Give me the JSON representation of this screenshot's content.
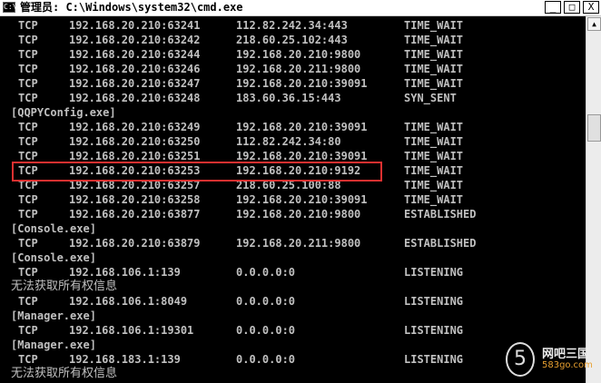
{
  "window": {
    "title": "管理员: C:\\Windows\\system32\\cmd.exe",
    "icon_label": "C:\\",
    "buttons": {
      "minimize": "_",
      "maximize": "□",
      "close": "X"
    }
  },
  "rows": [
    {
      "proto": "TCP",
      "local": "192.168.20.210:63241",
      "foreign": "112.82.242.34:443",
      "state": "TIME_WAIT"
    },
    {
      "proto": "TCP",
      "local": "192.168.20.210:63242",
      "foreign": "218.60.25.102:443",
      "state": "TIME_WAIT"
    },
    {
      "proto": "TCP",
      "local": "192.168.20.210:63244",
      "foreign": "192.168.20.210:9800",
      "state": "TIME_WAIT"
    },
    {
      "proto": "TCP",
      "local": "192.168.20.210:63246",
      "foreign": "192.168.20.211:9800",
      "state": "TIME_WAIT"
    },
    {
      "proto": "TCP",
      "local": "192.168.20.210:63247",
      "foreign": "192.168.20.210:39091",
      "state": "TIME_WAIT"
    },
    {
      "proto": "TCP",
      "local": "192.168.20.210:63248",
      "foreign": "183.60.36.15:443",
      "state": "SYN_SENT"
    },
    {
      "header": "[QQPYConfig.exe]"
    },
    {
      "proto": "TCP",
      "local": "192.168.20.210:63249",
      "foreign": "192.168.20.210:39091",
      "state": "TIME_WAIT"
    },
    {
      "proto": "TCP",
      "local": "192.168.20.210:63250",
      "foreign": "112.82.242.34:80",
      "state": "TIME_WAIT"
    },
    {
      "proto": "TCP",
      "local": "192.168.20.210:63251",
      "foreign": "192.168.20.210:39091",
      "state": "TIME_WAIT"
    },
    {
      "proto": "TCP",
      "local": "192.168.20.210:63253",
      "foreign": "192.168.20.210:9192",
      "state": "TIME_WAIT"
    },
    {
      "proto": "TCP",
      "local": "192.168.20.210:63257",
      "foreign": "218.60.25.100:88",
      "state": "TIME_WAIT"
    },
    {
      "proto": "TCP",
      "local": "192.168.20.210:63258",
      "foreign": "192.168.20.210:39091",
      "state": "TIME_WAIT"
    },
    {
      "proto": "TCP",
      "local": "192.168.20.210:63877",
      "foreign": "192.168.20.210:9800",
      "state": "ESTABLISHED"
    },
    {
      "header": "[Console.exe]"
    },
    {
      "proto": "TCP",
      "local": "192.168.20.210:63879",
      "foreign": "192.168.20.211:9800",
      "state": "ESTABLISHED"
    },
    {
      "header": "[Console.exe]"
    },
    {
      "proto": "TCP",
      "local": "192.168.106.1:139",
      "foreign": "0.0.0.0:0",
      "state": "LISTENING"
    },
    {
      "proto": "TCP",
      "local": "192.168.106.1:8049",
      "foreign": "0.0.0.0:0",
      "state": "LISTENING"
    },
    {
      "header": "[Manager.exe]"
    },
    {
      "proto": "TCP",
      "local": "192.168.106.1:19301",
      "foreign": "0.0.0.0:0",
      "state": "LISTENING"
    },
    {
      "header": "[Manager.exe]"
    },
    {
      "proto": "TCP",
      "local": "192.168.183.1:139",
      "foreign": "0.0.0.0:0",
      "state": "LISTENING"
    }
  ],
  "notices": [
    "无法获取所有权信息",
    "无法获取所有权信息"
  ],
  "watermark": {
    "glyph": "5",
    "text": "网吧三国",
    "sub": "583go.com"
  },
  "colors": {
    "highlight": "#e03030",
    "console_bg": "#000000",
    "console_fg": "#c0c0c0"
  }
}
